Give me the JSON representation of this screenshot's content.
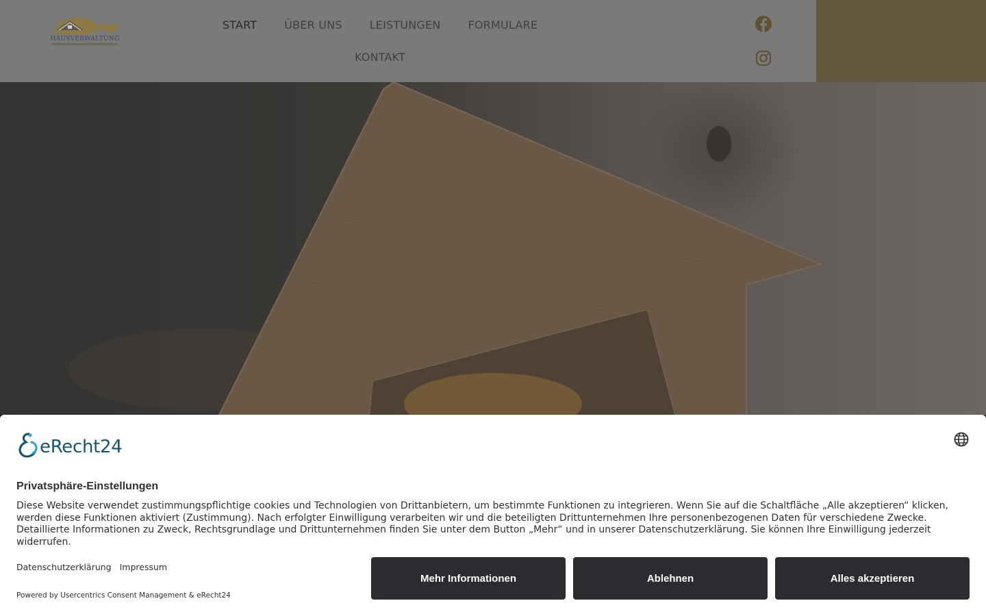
{
  "header": {
    "logo_text": "HAUSVERWALTUNG",
    "nav": [
      {
        "label": "START",
        "active": true
      },
      {
        "label": "ÜBER UNS"
      },
      {
        "label": "LEISTUNGEN"
      },
      {
        "label": "FORMULARE"
      },
      {
        "label": "KONTAKT"
      }
    ],
    "social": [
      "facebook-icon",
      "instagram-icon"
    ],
    "colors": {
      "bar": "#7a7a7a",
      "accent": "#62583d",
      "icon": "#5e5230"
    }
  },
  "consent": {
    "brand": "eRecht24",
    "title": "Privatsphäre-Einstellungen",
    "text": "Diese Website verwendet zustimmungspflichtige cookies und Technologien von Drittanbietern, um bestimmte Funktionen zu integrieren. Wenn Sie auf die Schaltfläche „Alle akzeptieren“ klicken, werden diese Funktionen aktiviert (Zustimmung). Nach erfolgter Einwilligung verarbeiten wir und die beteiligten Drittunternehmen Ihre personenbezogenen Daten für verschiedene Zwecke. Detaillierte Informationen zu Zweck, Rechtsgrundlage und Drittunternehmen finden Sie unter dem Button „Mehr“ und in unserer Datenschutzerklärung. Sie können Ihre Einwilligung jederzeit widerrufen.",
    "links": {
      "privacy": "Datenschutzerklärung",
      "imprint": "Impressum"
    },
    "powered": "Powered by Usercentrics Consent Management & eRecht24",
    "buttons": {
      "more": "Mehr Informationen",
      "deny": "Ablehnen",
      "accept": "Alles akzeptieren"
    },
    "colors": {
      "button": "#2b2c30",
      "brand": "#14566f"
    }
  }
}
